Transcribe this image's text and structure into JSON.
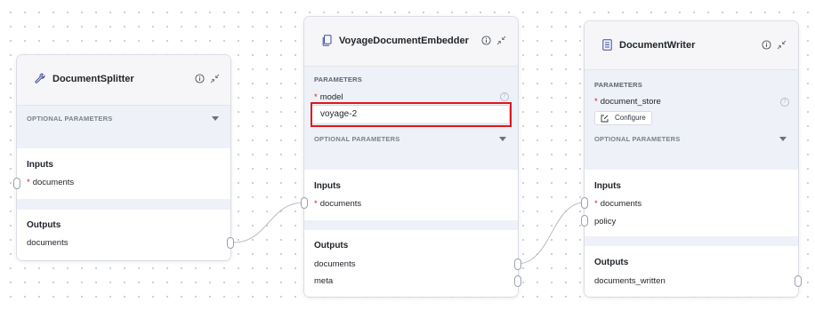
{
  "nodes": {
    "splitter": {
      "title": "DocumentSplitter",
      "icon": "wrench-icon",
      "optional_parameters_label": "OPTIONAL PARAMETERS",
      "inputs_label": "Inputs",
      "inputs": [
        {
          "name": "documents",
          "required": true
        }
      ],
      "outputs_label": "Outputs",
      "outputs": [
        {
          "name": "documents"
        }
      ]
    },
    "embedder": {
      "title": "VoyageDocumentEmbedder",
      "icon": "document-copy-icon",
      "parameters_label": "PARAMETERS",
      "model_label": "model",
      "model_value": "voyage-2",
      "optional_parameters_label": "OPTIONAL PARAMETERS",
      "inputs_label": "Inputs",
      "inputs": [
        {
          "name": "documents",
          "required": true
        }
      ],
      "outputs_label": "Outputs",
      "outputs": [
        {
          "name": "documents"
        },
        {
          "name": "meta"
        }
      ]
    },
    "writer": {
      "title": "DocumentWriter",
      "icon": "document-list-icon",
      "parameters_label": "PARAMETERS",
      "document_store_label": "document_store",
      "configure_label": "Configure",
      "optional_parameters_label": "OPTIONAL PARAMETERS",
      "inputs_label": "Inputs",
      "inputs": [
        {
          "name": "documents",
          "required": true
        },
        {
          "name": "policy",
          "required": false
        }
      ],
      "outputs_label": "Outputs",
      "outputs": [
        {
          "name": "documents_written"
        }
      ]
    }
  },
  "required_marker": "*",
  "highlight_color": "#e0161b",
  "accent_color": "#3b5bdb"
}
